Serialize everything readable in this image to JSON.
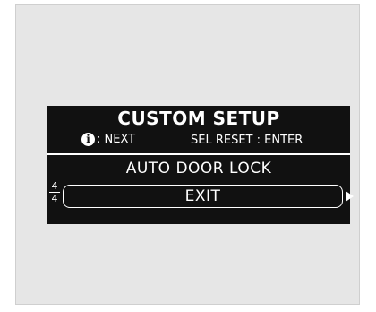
{
  "display": {
    "title": "CUSTOM SETUP",
    "info_icon_glyph": "i",
    "hint_next": ": NEXT",
    "hint_reset": "SEL RESET : ENTER",
    "item_label": "AUTO DOOR LOCK",
    "selected_option": "EXIT",
    "page_current": "4",
    "page_total": "4"
  },
  "colors": {
    "screen_background": "#111111",
    "screen_text": "#ffffff",
    "frame_background": "#e6e6e6"
  }
}
